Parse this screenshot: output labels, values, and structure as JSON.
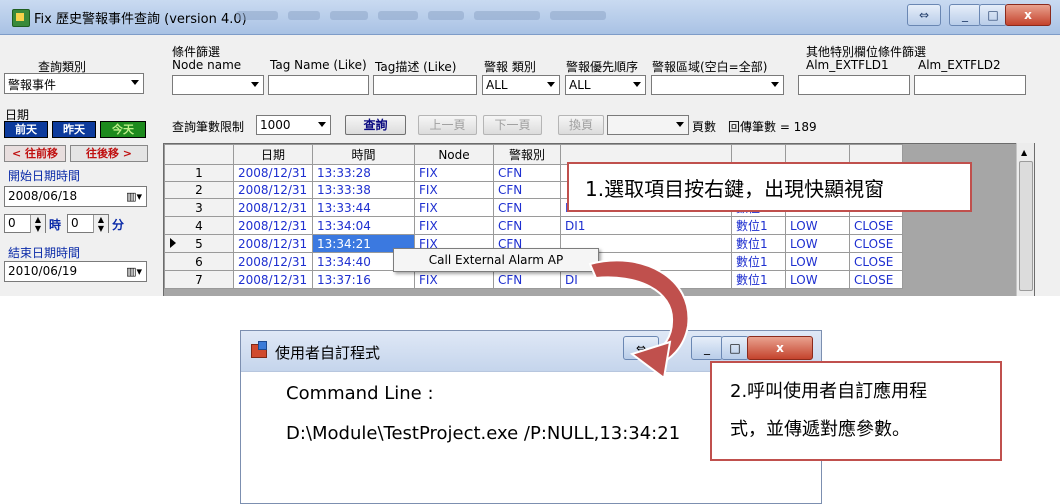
{
  "main_window": {
    "title": "Fix 歷史警報事件查詢",
    "version": "(version 4.0)",
    "buttons": {
      "restore": "⇔",
      "minimize": "_",
      "maximize": "□",
      "close": "x"
    }
  },
  "query_type": {
    "label": "查詢類別",
    "value": "警報事件"
  },
  "date_section": {
    "label": "日期"
  },
  "day_buttons": {
    "day_before": "前天",
    "yesterday": "昨天",
    "today": "今天"
  },
  "shift_buttons": {
    "back": "< 往前移",
    "forward": "往後移 >"
  },
  "start": {
    "label": "開始日期時間",
    "date": "2008/06/18",
    "hour": "0",
    "hour_unit": "時",
    "minute": "0",
    "minute_unit": "分"
  },
  "end": {
    "label": "結束日期時間",
    "date": "2010/06/19"
  },
  "filter": {
    "title": "條件篩選",
    "node_name": "Node name",
    "tag_name": "Tag Name (Like)",
    "tag_desc": "Tag描述 (Like)",
    "alarm_type": "警報 類別",
    "alarm_type_value": "ALL",
    "priority": "警報優先順序",
    "priority_value": "ALL",
    "area": "警報區域(空白=全部)"
  },
  "other_filter": {
    "title": "其他特別欄位條件篩選",
    "fld1": "Alm_EXTFLD1",
    "fld2": "Alm_EXTFLD2"
  },
  "toolbar": {
    "limit_label": "查詢筆數限制",
    "limit_value": "1000",
    "query": "查詢",
    "prev_page": "上一頁",
    "next_page": "下一頁",
    "change_page": "換頁",
    "page_label": "頁數",
    "returned": "回傳筆數 = 189"
  },
  "grid": {
    "columns": [
      "",
      "日期",
      "時間",
      "Node",
      "警報別"
    ],
    "rows": [
      [
        "1",
        "2008/12/31",
        "13:33:28",
        "FIX",
        "CFN",
        "",
        "",
        "",
        ""
      ],
      [
        "2",
        "2008/12/31",
        "13:33:38",
        "FIX",
        "CFN",
        "",
        "",
        "",
        ""
      ],
      [
        "3",
        "2008/12/31",
        "13:33:44",
        "FIX",
        "CFN",
        "DI",
        "數位1",
        "LOW",
        "CLOSE"
      ],
      [
        "4",
        "2008/12/31",
        "13:34:04",
        "FIX",
        "CFN",
        "DI1",
        "數位1",
        "LOW",
        "CLOSE"
      ],
      [
        "5",
        "2008/12/31",
        "13:34:21",
        "FIX",
        "CFN",
        "",
        "數位1",
        "LOW",
        "CLOSE"
      ],
      [
        "6",
        "2008/12/31",
        "13:34:40",
        "",
        "",
        "",
        "數位1",
        "LOW",
        "CLOSE"
      ],
      [
        "7",
        "2008/12/31",
        "13:37:16",
        "FIX",
        "CFN",
        "DI",
        "數位1",
        "LOW",
        "CLOSE"
      ]
    ]
  },
  "context_menu": {
    "item": "Call External Alarm AP"
  },
  "callouts": {
    "step1": "1.選取項目按右鍵，出現快顯視窗",
    "step2_line1": "2.呼叫使用者自訂應用程",
    "step2_line2": "式，並傳遞對應參數。"
  },
  "dialog": {
    "title": "使用者自訂程式",
    "command_label": "Command Line :",
    "command_value": "D:\\Module\\TestProject.exe /P:NULL,13:34:21",
    "buttons": {
      "restore": "⇔",
      "minimize": "_",
      "maximize": "□",
      "close": "x"
    }
  },
  "colors": {
    "callout_border": "#c0504d",
    "arrow": "#c0504d",
    "selected_cell": "#3b79e0",
    "grid_text": "#1e2fd0"
  }
}
